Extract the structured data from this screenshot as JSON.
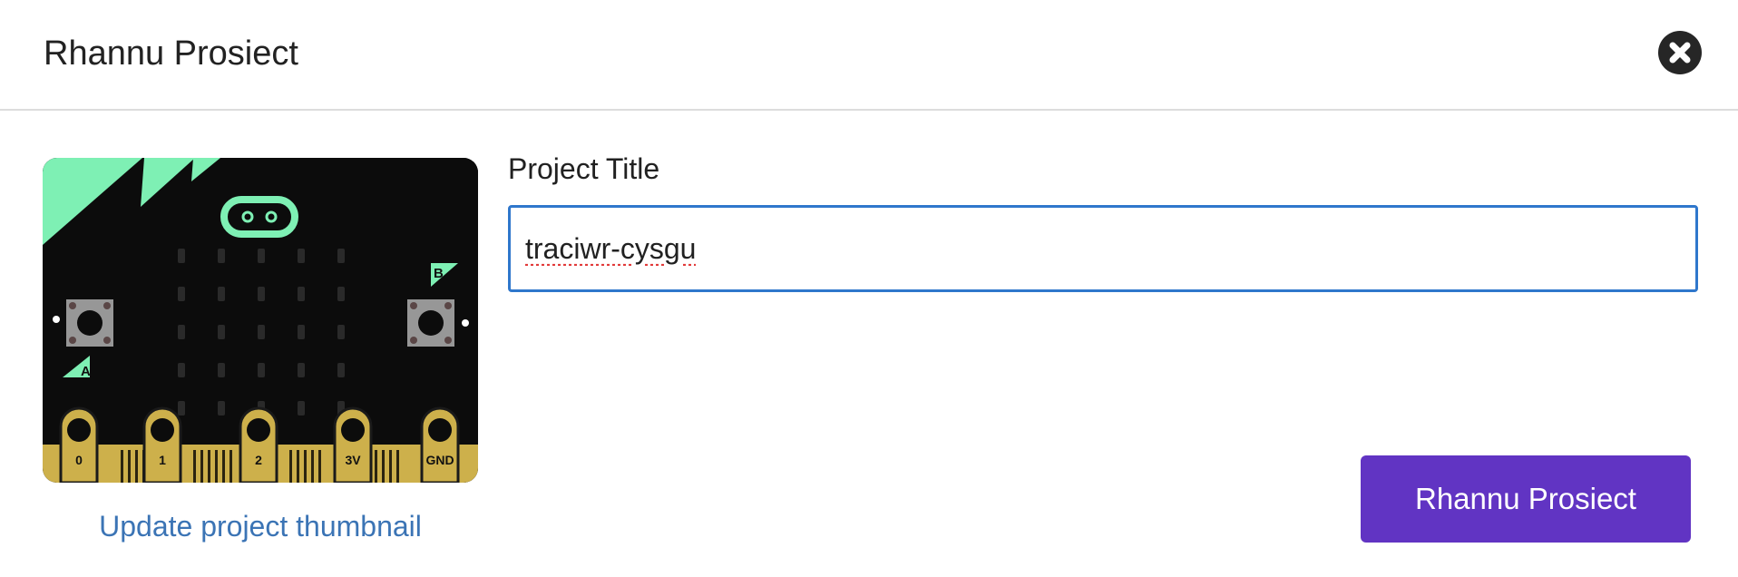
{
  "dialog": {
    "title": "Rhannu Prosiect",
    "close_icon": "close-icon"
  },
  "thumbnail": {
    "board_icon": "microbit-board-illustration",
    "pin_labels": [
      "0",
      "1",
      "2",
      "3V",
      "GND"
    ],
    "button_labels": [
      "A",
      "B"
    ],
    "update_link": "Update project thumbnail"
  },
  "project_title": {
    "label": "Project Title",
    "value": "traciwr-cysgu"
  },
  "actions": {
    "share_label": "Rhannu Prosiect"
  },
  "colors": {
    "accent": "#6134c3",
    "link": "#3b74b5",
    "input_border": "#2f77cc",
    "board_green": "#7ef0b4",
    "board_gold": "#cdb04b"
  }
}
